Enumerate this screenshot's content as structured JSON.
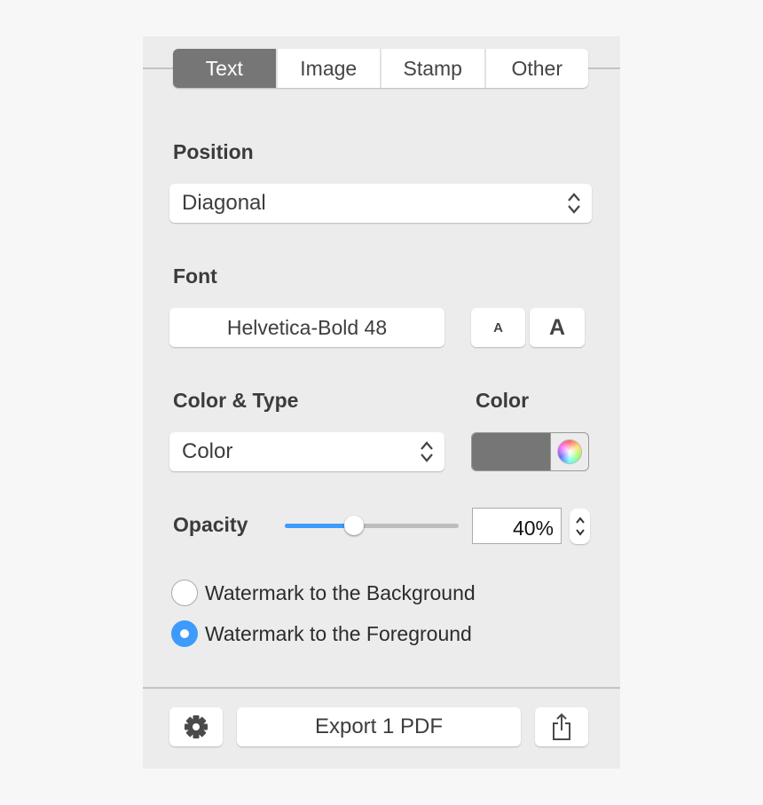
{
  "tabs": [
    {
      "label": "Text",
      "active": true
    },
    {
      "label": "Image"
    },
    {
      "label": "Stamp"
    },
    {
      "label": "Other"
    }
  ],
  "position": {
    "label": "Position",
    "value": "Diagonal"
  },
  "font": {
    "label": "Font",
    "value": "Helvetica-Bold 48",
    "smaller_label": "A",
    "larger_label": "A"
  },
  "color_type": {
    "label": "Color & Type",
    "value": "Color"
  },
  "color": {
    "label": "Color",
    "swatch": "#767676"
  },
  "opacity": {
    "label": "Opacity",
    "value": "40%",
    "percent": 40,
    "accent": "#3d9bfb"
  },
  "layer": {
    "options": [
      {
        "label": "Watermark to the Background",
        "selected": false
      },
      {
        "label": "Watermark to the Foreground",
        "selected": true
      }
    ]
  },
  "footer": {
    "export_label": "Export 1 PDF",
    "settings_icon": "gear-icon",
    "share_icon": "share-icon"
  }
}
